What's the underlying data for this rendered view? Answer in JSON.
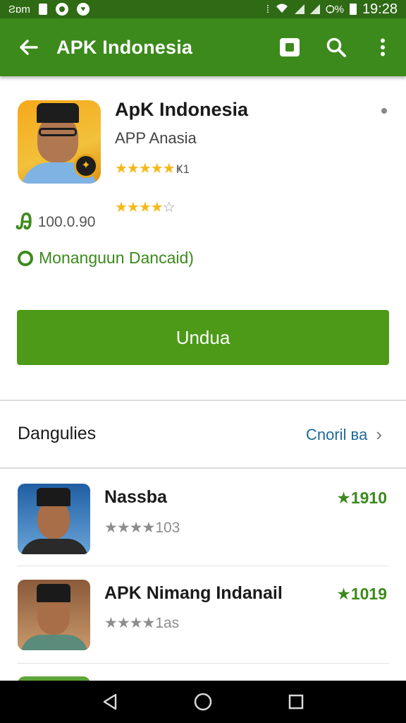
{
  "status_bar": {
    "carrier": "Ƨɒm",
    "battery_percent": "Ѻ%",
    "time": "19:28"
  },
  "app_bar": {
    "title": "APK Indonesia",
    "back_icon": "arrow-left-icon",
    "action_icons": [
      "screen-record-icon",
      "search-icon",
      "more-vert-icon"
    ]
  },
  "app": {
    "name": "ApK Indonesia",
    "developer": "APP Anasia",
    "rating_suffix": "Ҝ1",
    "rating_stars": 5,
    "user_rating_stars": 4,
    "size_icon": "Ꭿ",
    "size": "100.0.90",
    "status": "Monanguun Dancaid)",
    "install_label": "Undua"
  },
  "section": {
    "title": "Dangulies",
    "more_label": "Cnoril",
    "more_badge": "ʙa"
  },
  "related": [
    {
      "name": "Nassba",
      "stars": 4,
      "count": "103",
      "price": "★1910"
    },
    {
      "name": "APK Nimang Indanail",
      "stars": 4,
      "count": "1as",
      "price": "★1019"
    }
  ],
  "colors": {
    "status_bar": "#2f6a14",
    "app_bar": "#3c8a1c",
    "install_button": "#4c9a17",
    "accent_green": "#3c8a1c",
    "star_gold": "#f5b819",
    "link_blue": "#1e6a98"
  },
  "nav_bar": {
    "icons": [
      "back-triangle-icon",
      "home-circle-icon",
      "recents-square-icon"
    ]
  }
}
